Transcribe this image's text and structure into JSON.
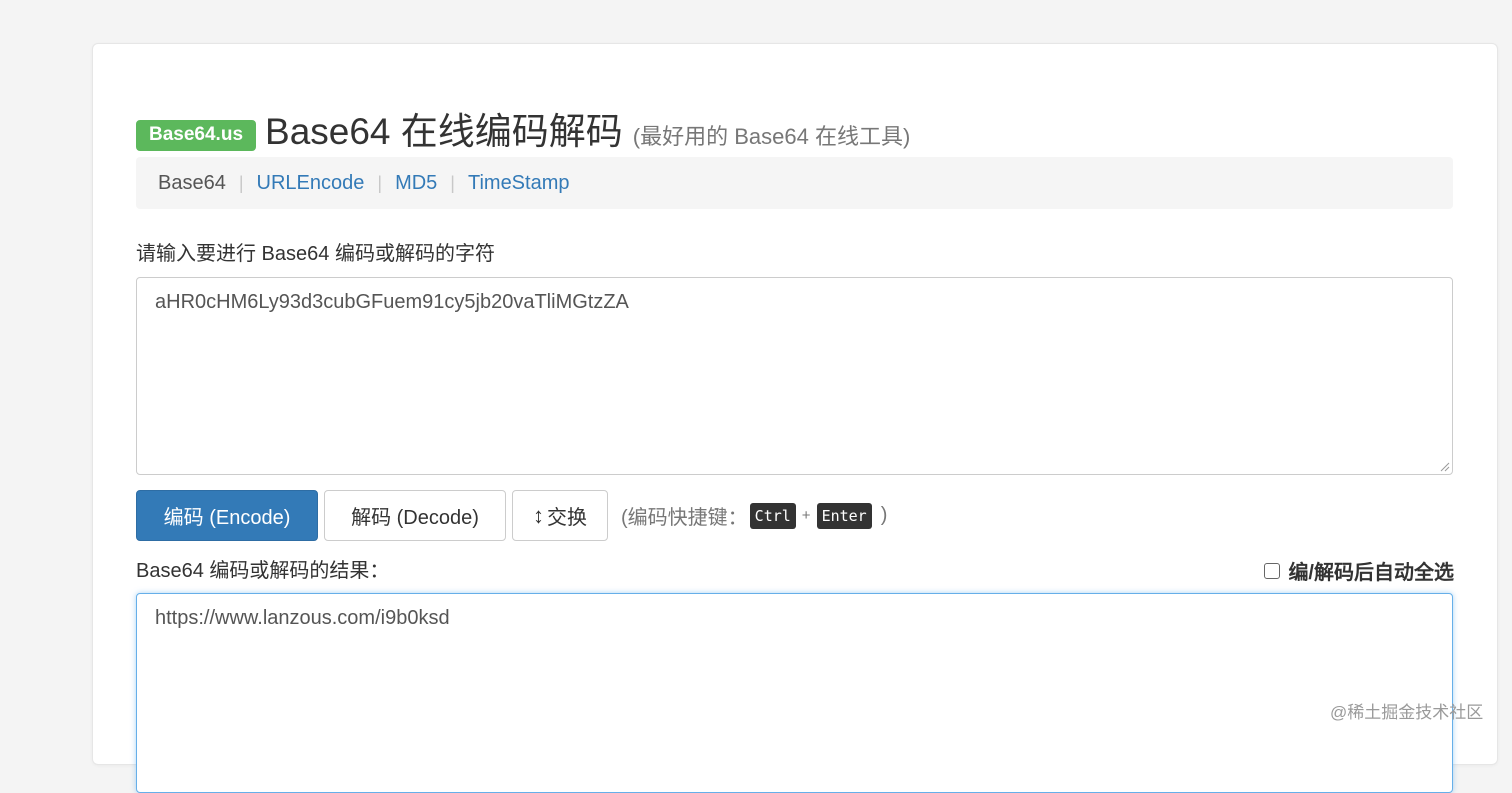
{
  "header": {
    "badge": "Base64.us",
    "title": "Base64 在线编码解码",
    "subtitle": "(最好用的 Base64 在线工具)"
  },
  "nav": {
    "items": [
      {
        "label": "Base64",
        "active": true
      },
      {
        "label": "URLEncode",
        "active": false
      },
      {
        "label": "MD5",
        "active": false
      },
      {
        "label": "TimeStamp",
        "active": false
      }
    ],
    "separator": "|"
  },
  "input": {
    "label": "请输入要进行 Base64 编码或解码的字符",
    "value": "aHR0cHM6Ly93d3cubGFuem91cy5jb20vaTliMGtzZA"
  },
  "buttons": {
    "encode": "编码 (Encode)",
    "decode": "解码 (Decode)",
    "swap_icon": "↕",
    "swap": "交换"
  },
  "shortcut": {
    "prefix": "(编码快捷键：",
    "key1": "Ctrl",
    "plus": "+",
    "key2": "Enter",
    "suffix": ")"
  },
  "result": {
    "label": "Base64 编码或解码的结果：",
    "value": "https://www.lanzous.com/i9b0ksd",
    "autoselect_label": "编/解码后自动全选",
    "autoselect_checked": false
  },
  "watermark": "@稀土掘金技术社区",
  "colors": {
    "badge": "#5cb85c",
    "primary": "#337ab7",
    "focus_border": "#66afe9"
  }
}
